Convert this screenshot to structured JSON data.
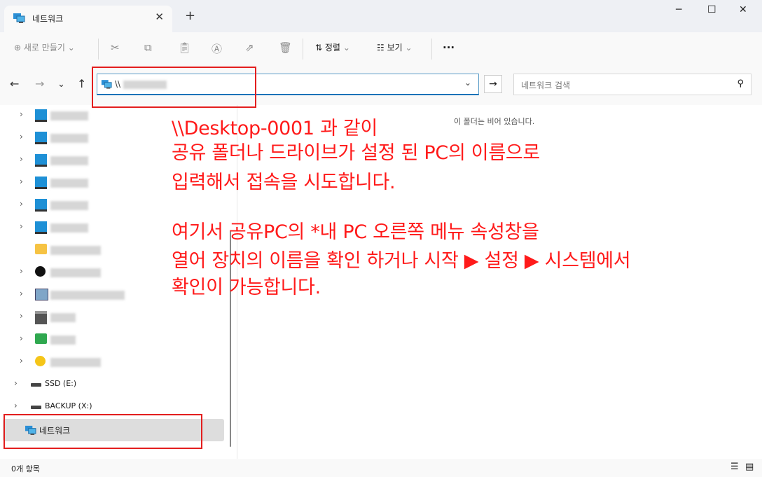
{
  "tab": {
    "title": "네트워크",
    "close": "✕",
    "new_tab": "+"
  },
  "window_controls": {
    "minimize": "─",
    "maximize": "☐",
    "close": "✕"
  },
  "toolbar": {
    "new_label": "새로 만들기",
    "sort_label": "정렬",
    "view_label": "보기",
    "more": "···"
  },
  "address": {
    "path_prefix": "\\\\",
    "go": "→"
  },
  "search": {
    "placeholder": "네트워크 검색"
  },
  "content": {
    "empty_message": "이 폴더는 비어 있습니다."
  },
  "annotation": {
    "line1": "\\\\Desktop-0001 과 같이",
    "line2": "공유 폴더나 드라이브가 설정 된 PC의 이름으로",
    "line3": "입력해서 접속을 시도합니다.",
    "line4": "여기서 공유PC의 *내 PC 오른쪽 메뉴 속성창을",
    "line5": "열어 장치의 이름을 확인 하거나 시작 ▶ 설정 ▶ 시스템에서",
    "line6": "확인이 가능합니다."
  },
  "sidebar": {
    "drives": [
      {
        "label": "SSD (E:)"
      },
      {
        "label": "BACKUP (X:)"
      }
    ],
    "network": {
      "label": "네트워크"
    }
  },
  "status": {
    "count": "0개 항목"
  },
  "colors": {
    "annotation": "#ff1a1a",
    "selection": "#dddddd",
    "address_border": "#1a73b8"
  }
}
